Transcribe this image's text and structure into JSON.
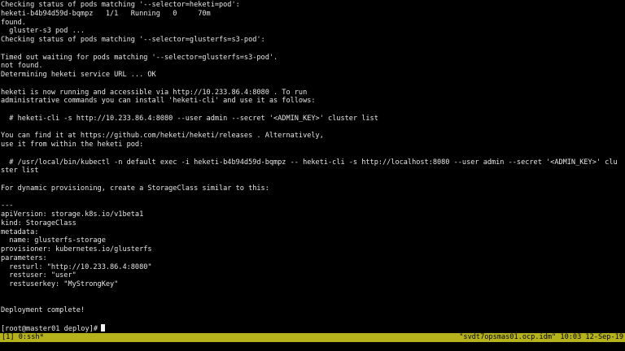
{
  "terminal": {
    "lines": [
      "Checking status of pods matching '--selector=heketi=pod':",
      "heketi-b4b94d59d-bqmpz   1/1   Running   0     70m",
      "found.",
      "  gluster-s3 pod ...",
      "Checking status of pods matching '--selector=glusterfs=s3-pod':",
      "",
      "Timed out waiting for pods matching '--selector=glusterfs=s3-pod'.",
      "not found.",
      "Determining heketi service URL ... OK",
      "",
      "heketi is now running and accessible via http://10.233.86.4:8080 . To run",
      "administrative commands you can install 'heketi-cli' and use it as follows:",
      "",
      "  # heketi-cli -s http://10.233.86.4:8080 --user admin --secret '<ADMIN_KEY>' cluster list",
      "",
      "You can find it at https://github.com/heketi/heketi/releases . Alternatively,",
      "use it from within the heketi pod:",
      "",
      "  # /usr/local/bin/kubectl -n default exec -i heketi-b4b94d59d-bqmpz -- heketi-cli -s http://localhost:8080 --user admin --secret '<ADMIN_KEY>' clu",
      "ster list",
      "",
      "For dynamic provisioning, create a StorageClass similar to this:",
      "",
      "---",
      "apiVersion: storage.k8s.io/v1beta1",
      "kind: StorageClass",
      "metadata:",
      "  name: glusterfs-storage",
      "provisioner: kubernetes.io/glusterfs",
      "parameters:",
      "  resturl: \"http://10.233.86.4:8080\"",
      "  restuser: \"user\"",
      "  restuserkey: \"MyStrongKey\"",
      "",
      "",
      "Deployment complete!",
      ""
    ],
    "prompt": "[root@master01 deploy]#"
  },
  "status_bar": {
    "left": "[1] 0:ssh*",
    "right": "\"svdt7opsmas01.ocp.idm\" 10:03 12-Sep-19"
  },
  "colors": {
    "background": "#000000",
    "foreground": "#e6e6e6",
    "status_bar_bg": "#b5b21c",
    "status_bar_fg": "#000000",
    "cursor": "#f2f2f2"
  }
}
